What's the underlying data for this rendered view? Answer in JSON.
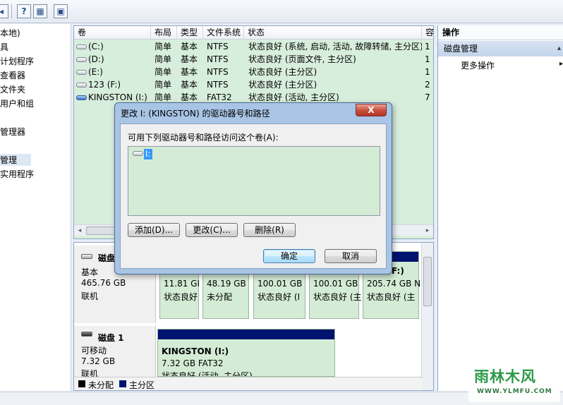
{
  "toolbar": {
    "icons": [
      "back-icon",
      "help-icon",
      "properties-icon",
      "console-icon"
    ],
    "help_glyph": "?"
  },
  "tree": {
    "items": [
      {
        "label": "本地)"
      },
      {
        "label": "具"
      },
      {
        "label": "计划程序"
      },
      {
        "label": "查看器"
      },
      {
        "label": "文件夹"
      },
      {
        "label": "用户和组"
      },
      {
        "label": "管理器"
      },
      {
        "label": "管理"
      },
      {
        "label": "实用程序"
      }
    ]
  },
  "volumes": {
    "columns": [
      "卷",
      "布局",
      "类型",
      "文件系统",
      "状态",
      "容"
    ],
    "rows": [
      {
        "name": "(C:)",
        "layout": "简单",
        "type": "基本",
        "fs": "NTFS",
        "status": "状态良好 (系统, 启动, 活动, 故障转储, 主分区)",
        "cap": "1"
      },
      {
        "name": "(D:)",
        "layout": "简单",
        "type": "基本",
        "fs": "NTFS",
        "status": "状态良好 (页面文件, 主分区)",
        "cap": "1"
      },
      {
        "name": "(E:)",
        "layout": "简单",
        "type": "基本",
        "fs": "NTFS",
        "status": "状态良好 (主分区)",
        "cap": "1"
      },
      {
        "name": "123 (F:)",
        "layout": "简单",
        "type": "基本",
        "fs": "NTFS",
        "status": "状态良好 (主分区)",
        "cap": "2"
      },
      {
        "name": "KINGSTON (I:)",
        "layout": "简单",
        "type": "基本",
        "fs": "FAT32",
        "status": "状态良好 (活动, 主分区)",
        "cap": "7"
      }
    ]
  },
  "disk0": {
    "title": "磁盘",
    "type": "基本",
    "size": "465.76 GB",
    "status": "联机",
    "partitions": [
      {
        "size": "11.81 GI",
        "status": "状态良好"
      },
      {
        "size": "48.19 GB",
        "status": "未分配"
      },
      {
        "size": "100.01 GB",
        "status": "状态良好 (I"
      },
      {
        "size": "100.01 GB",
        "status": "状态良好 (主"
      },
      {
        "name": "F:)",
        "size": "205.74 GB N",
        "status": "状态良好 (主"
      }
    ]
  },
  "disk1": {
    "title": "磁盘 1",
    "type": "可移动",
    "size": "7.32 GB",
    "status": "联机",
    "partition": {
      "name": "KINGSTON  (I:)",
      "size": "7.32 GB FAT32",
      "status": "状态良好 (活动, 主分区)"
    }
  },
  "legend": {
    "unallocated": "未分配",
    "primary": "主分区",
    "unallocated_color": "#000000",
    "primary_color": "#00136e"
  },
  "actions": {
    "title": "操作",
    "section": "磁盘管理",
    "more": "更多操作"
  },
  "dialog": {
    "title": "更改 I: (KINGSTON) 的驱动器号和路径",
    "close": "X",
    "prompt": "可用下列驱动器号和路径访问这个卷(A):",
    "list_items": [
      "I:"
    ],
    "add": "添加(D)...",
    "change": "更改(C)...",
    "remove": "删除(R)",
    "ok": "确定",
    "cancel": "取消"
  },
  "watermark": {
    "main": "雨林木风",
    "sub": "WWW.YLMFU.COM"
  },
  "colors": {
    "partition_fill": "#d4ecd5",
    "partition_bar": "#00136e",
    "selection": "#3399ff",
    "close_button": "#c84c3a"
  }
}
